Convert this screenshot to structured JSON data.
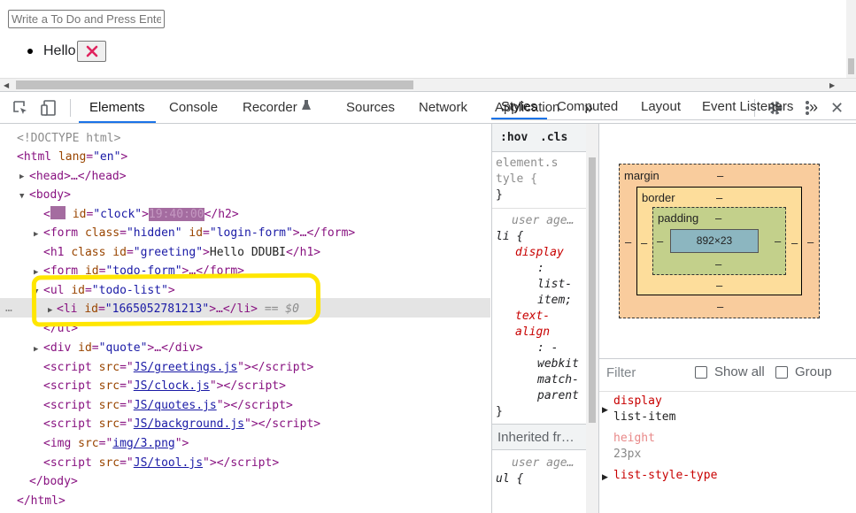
{
  "page": {
    "input_placeholder": "Write a To Do and Press Enter",
    "todo_item_text": "Hello",
    "delete_button_glyph": "❌"
  },
  "devtools": {
    "tabs": [
      "Elements",
      "Console",
      "Recorder",
      "Sources",
      "Network",
      "Application"
    ],
    "more_glyph": "»",
    "settings_icon": "gear-icon",
    "menu_icon": "kebab-icon",
    "close_glyph": "✕",
    "styles_tabs": [
      "Styles",
      "Computed",
      "Layout",
      "Event Listeners"
    ],
    "more_tabs_glyph": "»"
  },
  "dom": {
    "doctype": "<!DOCTYPE html>",
    "html_open_tag": "<html ",
    "html_attr": "lang",
    "html_val": "\"en\"",
    "head_collapsed": "<head>…</head>",
    "body_open": "<body>",
    "clock_id": "\"clock\"",
    "clock_time": "19:40:00",
    "clock_close": "</h2>",
    "form_login": {
      "class": "\"hidden\"",
      "id": "\"login-form\"",
      "tail": ">…</form>"
    },
    "greeting": {
      "id": "\"greeting\"",
      "text": "Hello DDUBI",
      "close": "</h1>"
    },
    "todo_form": {
      "id": "\"todo-form\"",
      "tail": ">…</form>"
    },
    "todo_list": {
      "id": "\"todo-list\""
    },
    "li": {
      "id": "\"1665052781213\"",
      "tail": ">…</li>",
      "marker": "== $0"
    },
    "ul_close": "</ul>",
    "quote": {
      "id": "\"quote\"",
      "tail": ">…</div>"
    },
    "scripts": [
      "JS/greetings.js",
      "JS/clock.js",
      "JS/quotes.js",
      "JS/background.js"
    ],
    "img_src": "img/3.png",
    "tool_script": "JS/tool.js",
    "body_close": "</body>",
    "html_close": "</html>",
    "ellipsis": "…"
  },
  "styles": {
    "hov": ":hov",
    "cls": ".cls",
    "element_style": [
      "element.s",
      "tyle {",
      "}"
    ],
    "ua_label": "user age…",
    "li_selector": "li {",
    "rules": [
      {
        "prop": "display",
        "lines": [
          ":",
          "list-",
          "item;"
        ]
      },
      {
        "prop": "text-",
        "prop2": "align",
        "lines": [
          ": -",
          "webkit",
          "match-",
          "parent"
        ]
      }
    ],
    "close_brace": "}",
    "inherited": "Inherited fr…",
    "ua_label2": "user age…",
    "ul_selector": "ul {"
  },
  "computed": {
    "box": {
      "margin_label": "margin",
      "border_label": "border",
      "padding_label": "padding",
      "content_size": "892×23",
      "dash": "–"
    },
    "filter_placeholder": "Filter",
    "show_all": "Show all",
    "group": "Group",
    "props": [
      {
        "name": "display",
        "value": "list-item",
        "active": true
      },
      {
        "name": "height",
        "value": "23px",
        "active": false
      },
      {
        "name": "list-style-type",
        "value": "",
        "active": true
      }
    ]
  },
  "colors": {
    "tag": "#881280",
    "attr": "#994500",
    "value": "#1a1aa6",
    "highlight": "#ffe600",
    "accent": "#1a73e8"
  }
}
